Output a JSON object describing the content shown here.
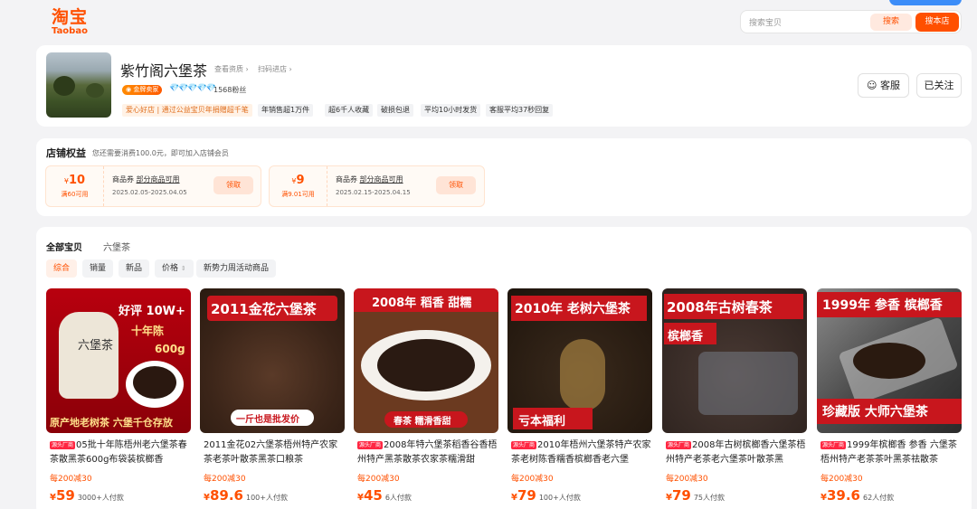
{
  "brand": {
    "cn": "淘宝",
    "en": "Taobao",
    "color": "#ff5000"
  },
  "search": {
    "placeholder": "搜索宝贝",
    "btn_search": "搜索",
    "btn_shop": "搜本店"
  },
  "shop": {
    "name": "紫竹阁六堡茶",
    "link_qual": "查看资质",
    "link_scan": "扫码进店",
    "badge": "金牌卖家",
    "diamonds": "💎💎💎💎💎",
    "fans": "1568粉丝",
    "tags": [
      "爱心好店 | 通过公益宝贝年捐赠超千笔",
      "年销售超1万件",
      "超6千人收藏",
      "破损包退",
      "平均10小时发货",
      "客服平均37秒回复"
    ],
    "service_label": "客服",
    "follow_label": "已关注"
  },
  "benefits": {
    "title": "店铺权益",
    "subtitle": "您还需要消费100.0元，即可加入店铺会员",
    "coupons": [
      {
        "amount": "10",
        "currency": "¥",
        "condition": "满60可用",
        "label": "商品券",
        "scope": "部分商品可用",
        "date": "2025.02.05-2025.04.05",
        "get": "领取"
      },
      {
        "amount": "9",
        "currency": "¥",
        "condition": "满9.01可用",
        "label": "商品券",
        "scope": "部分商品可用",
        "date": "2025.02.15-2025.04.15",
        "get": "领取"
      }
    ]
  },
  "items": {
    "tab_all": "全部宝贝",
    "tab_cat": "六堡茶",
    "sorts": [
      "综合",
      "销量",
      "新品",
      "价格",
      "新势力周活动商品"
    ],
    "price_chevron": "⇕",
    "products": [
      {
        "img_texts": [
          "好评 10W+",
          "十年陈",
          "600g",
          "六堡茶",
          "原产地老树茶  六堡千仓存放"
        ],
        "mark": "源头厂商",
        "title": "05批十年陈梧州老六堡茶春茶散黑茶600g布袋装槟榔香",
        "promo": "每200减30",
        "currency": "¥",
        "price": "59",
        "sold": "3000+人付款"
      },
      {
        "img_texts": [
          "2011金花六堡茶",
          "一斤也是批发价"
        ],
        "mark": "",
        "title": "2011金花02六堡茶梧州特产农家茶老茶叶散茶黑茶口粮茶",
        "promo": "每200减30",
        "currency": "¥",
        "price": "89.6",
        "sold": "100+人付款"
      },
      {
        "img_texts": [
          "2008年 稻香 甜糯",
          "春茶 糯滑香甜"
        ],
        "mark": "源头厂商",
        "title": "2008年特六堡茶稻香谷香梧州特产黑茶散茶农家茶糯滑甜",
        "promo": "每200减30",
        "currency": "¥",
        "price": "45",
        "sold": "6人付款"
      },
      {
        "img_texts": [
          "2010年 老树六堡茶",
          "亏本福利"
        ],
        "mark": "源头厂商",
        "title": "2010年梧州六堡茶特产农家茶老树陈香糯香槟榔香老六堡",
        "promo": "每200减30",
        "currency": "¥",
        "price": "79",
        "sold": "100+人付款"
      },
      {
        "img_texts": [
          "2008年古树春茶",
          "槟榔香"
        ],
        "mark": "源头厂商",
        "title": "2008年古树槟榔香六堡茶梧州特产老茶老六堡茶叶散茶黑",
        "promo": "每200减30",
        "currency": "¥",
        "price": "79",
        "sold": "75人付款"
      },
      {
        "img_texts": [
          "1999年 参香 槟榔香",
          "珍藏版 大师六堡茶"
        ],
        "mark": "源头厂商",
        "title": "1999年槟榔香 参香 六堡茶梧州特产老茶茶叶黑茶祛散茶",
        "promo": "每200减30",
        "currency": "¥",
        "price": "39.6",
        "sold": "62人付款"
      }
    ]
  }
}
